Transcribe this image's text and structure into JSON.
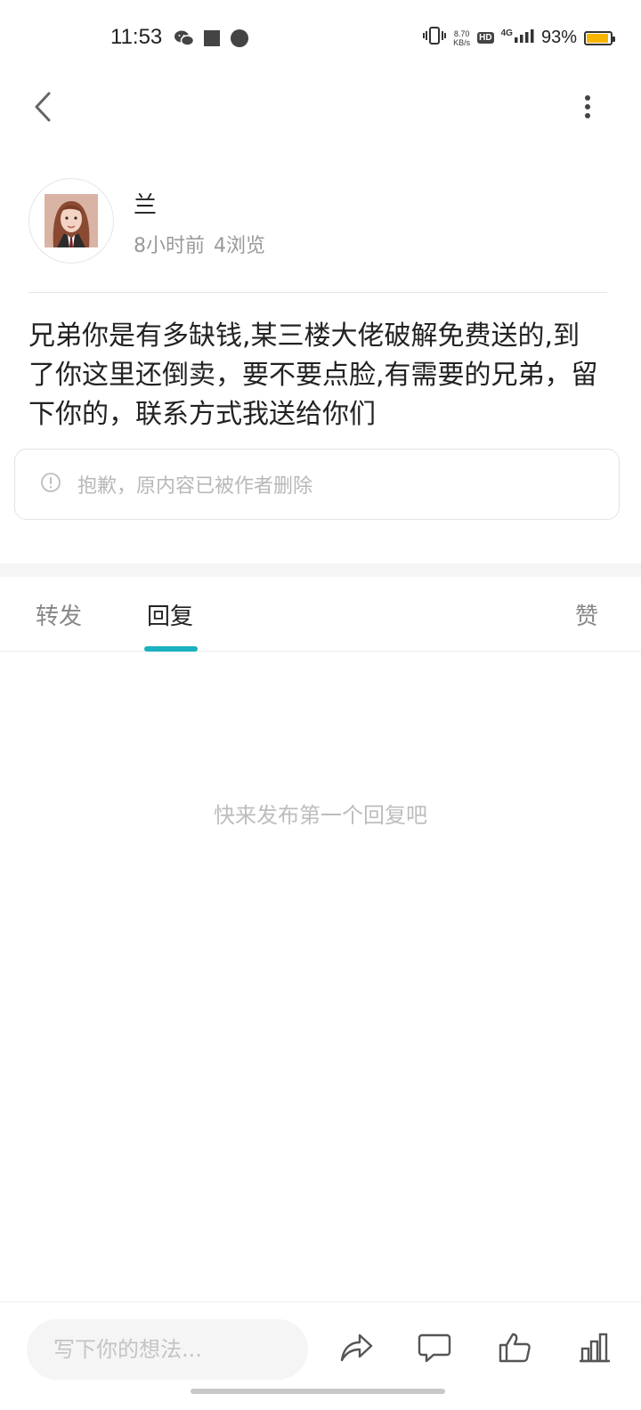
{
  "status_bar": {
    "time": "11:53",
    "net_speed_value": "8.70",
    "net_speed_unit": "KB/s",
    "hd": "HD",
    "network": "4G",
    "battery_percent": "93%",
    "battery_level": 0.93,
    "icons": [
      "wechat-icon",
      "stop-square-icon",
      "navigation-compass-icon",
      "vibrate-icon",
      "signal-icon",
      "battery-icon"
    ]
  },
  "post": {
    "author": "兰",
    "time_ago": "8小时前",
    "views": "4浏览",
    "content": "兄弟你是有多缺钱,某三楼大佬破解免费送的,到了你这里还倒卖，要不要点脸,有需要的兄弟，留下你的，联系方式我送给你们",
    "deleted_notice": "抱歉，原内容已被作者删除"
  },
  "tabs": {
    "repost": "转发",
    "reply": "回复",
    "like": "赞",
    "active": "reply"
  },
  "replies": {
    "empty_text": "快来发布第一个回复吧"
  },
  "bottom_bar": {
    "placeholder": "写下你的想法...",
    "icons": [
      "share-icon",
      "comment-icon",
      "like-icon",
      "stats-icon"
    ]
  },
  "colors": {
    "accent": "#1bb1c0",
    "battery": "#f7b500"
  }
}
